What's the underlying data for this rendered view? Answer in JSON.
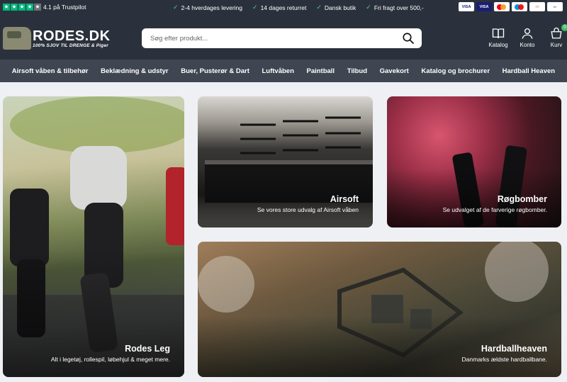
{
  "topbar": {
    "trustpilot_text": "4.1 på Trustpilot",
    "usps": [
      "2-4 hverdages levering",
      "14 dages returret",
      "Dansk butik",
      "Fri fragt over 500,-"
    ],
    "payments": [
      "VISA",
      "VISA",
      "mastercard",
      "maestro",
      "dankort",
      "mobilepay"
    ]
  },
  "header": {
    "logo_text": "RODES.DK",
    "logo_tagline": "100% SJOV TIL DRENGE & Piger",
    "search_placeholder": "Søg efter produkt...",
    "icons": [
      {
        "label": "Katalog",
        "icon": "book-icon"
      },
      {
        "label": "Konto",
        "icon": "user-icon"
      },
      {
        "label": "Kurv",
        "icon": "basket-icon",
        "badge": "0"
      }
    ]
  },
  "nav": {
    "items": [
      "Airsoft våben & tilbehør",
      "Beklædning & udstyr",
      "Buer, Pusterør & Dart",
      "Luftvåben",
      "Paintball",
      "Tilbud",
      "Gavekort",
      "Katalog og brochurer",
      "Hardball Heaven"
    ]
  },
  "tiles": [
    {
      "title": "Rodes Leg",
      "subtitle": "Alt i legetøj, rollespil, løbehjul & meget mere."
    },
    {
      "title": "Airsoft",
      "subtitle": "Se vores store udvalg af Airsoft våben"
    },
    {
      "title": "Røgbomber",
      "subtitle": "Se udvalget af de farverige røgbomber."
    },
    {
      "title": "Hardballheaven",
      "subtitle": "Danmarks ældste hardballbane."
    }
  ]
}
